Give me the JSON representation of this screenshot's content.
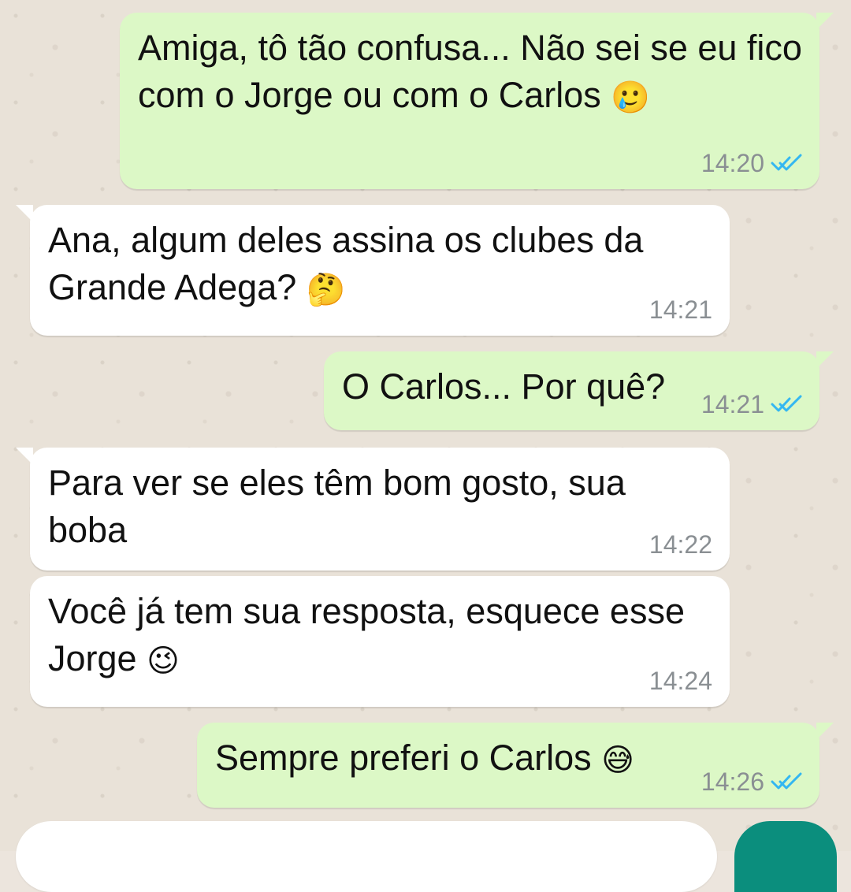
{
  "chat": {
    "messages": [
      {
        "direction": "outgoing",
        "text": "Amiga, tô tão confusa... Não sei se eu fico com o Jorge ou com o Carlos",
        "emoji": "🥲",
        "time": "14:20",
        "status": "read"
      },
      {
        "direction": "incoming",
        "text": "Ana, algum deles assina os clubes da Grande Adega?",
        "emoji": "🤔",
        "time": "14:21"
      },
      {
        "direction": "outgoing",
        "text": "O Carlos... Por quê?",
        "emoji": "",
        "time": "14:21",
        "status": "read"
      },
      {
        "direction": "incoming",
        "text": "Para ver se eles têm bom gosto, sua boba",
        "emoji": "",
        "time": "14:22"
      },
      {
        "direction": "incoming",
        "text": "Você já tem sua resposta, esquece esse Jorge",
        "emoji": "😉",
        "time": "14:24"
      },
      {
        "direction": "outgoing",
        "text": "Sempre preferi o Carlos",
        "emoji": "😅",
        "time": "14:26",
        "status": "read"
      }
    ]
  },
  "colors": {
    "outgoing_bubble": "#DCF8C6",
    "incoming_bubble": "#FFFFFF",
    "wallpaper": "#E9E2D8",
    "timestamp": "#8A8F93",
    "read_ticks": "#34B7F1",
    "send_button": "#0B8E7D"
  },
  "icons": {
    "read_receipt": "double-check-icon"
  }
}
